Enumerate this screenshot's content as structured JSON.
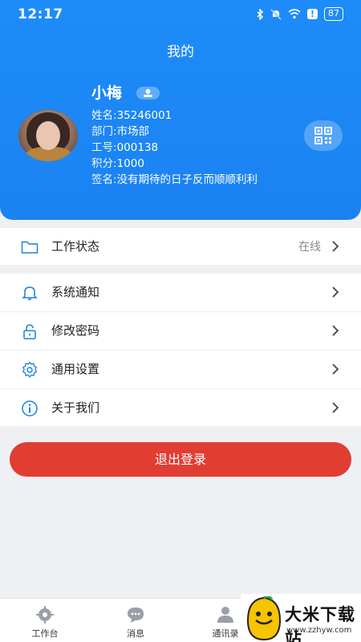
{
  "status": {
    "time": "12:17",
    "battery": "87",
    "icons": [
      "bluetooth-icon",
      "mute-icon",
      "wifi-icon",
      "alert-icon",
      "battery-icon"
    ]
  },
  "header": {
    "title": "我的"
  },
  "profile": {
    "name": "小梅",
    "fields": [
      {
        "label": "姓名:",
        "value": "35246001"
      },
      {
        "label": "部门:",
        "value": "市场部"
      },
      {
        "label": "工号:",
        "value": "000138"
      },
      {
        "label": "积分:",
        "value": "1000"
      },
      {
        "label": "签名:",
        "value": "没有期待的日子反而顺顺利利"
      }
    ]
  },
  "work_status": {
    "label": "工作状态",
    "value": "在线",
    "icon": "folder-icon"
  },
  "menu": [
    {
      "label": "系统通知",
      "icon": "bell-icon"
    },
    {
      "label": "修改密码",
      "icon": "lock-icon"
    },
    {
      "label": "通用设置",
      "icon": "gear-icon"
    },
    {
      "label": "关于我们",
      "icon": "info-icon"
    }
  ],
  "logout_label": "退出登录",
  "tabs": [
    {
      "label": "工作台",
      "icon": "workbench-icon"
    },
    {
      "label": "消息",
      "icon": "message-icon"
    },
    {
      "label": "通讯录",
      "icon": "contacts-icon"
    }
  ],
  "watermark": {
    "title": "大米下载站",
    "url": "www.zzhyw.com"
  },
  "colors": {
    "primary": "#1d8cf8",
    "danger": "#e13d33",
    "icon_blue": "#1a7fe0",
    "background": "#eff0f4"
  }
}
